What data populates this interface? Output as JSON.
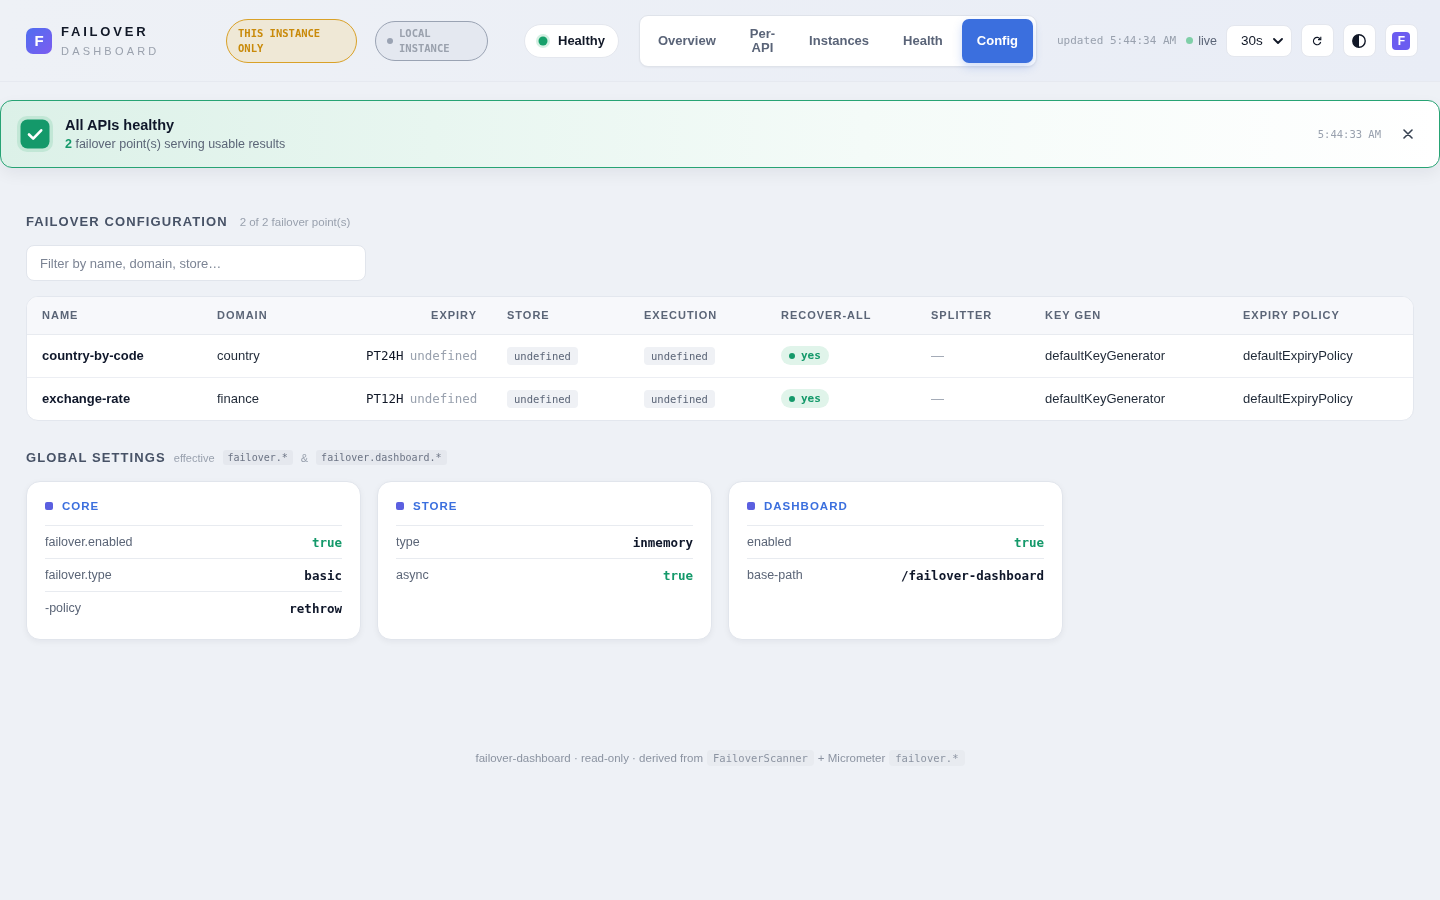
{
  "brand": {
    "logo": "F",
    "title": "FAILOVER",
    "subtitle": "DASHBOARD"
  },
  "badges": [
    {
      "kind": "scope",
      "label": "THIS INSTANCE ONLY"
    },
    {
      "kind": "local",
      "label": "LOCAL INSTANCE"
    }
  ],
  "health": {
    "kind": "ok",
    "label": "Healthy"
  },
  "tabs": [
    {
      "label": "Overview",
      "selected": false
    },
    {
      "label": "Per-API",
      "selected": false
    },
    {
      "label": "Instances",
      "selected": false
    },
    {
      "label": "Health",
      "selected": false
    },
    {
      "label": "Config",
      "selected": true
    }
  ],
  "updated": "updated 5:44:34 AM",
  "live": {
    "label": "live",
    "on": true
  },
  "interval": {
    "value": "30s"
  },
  "app_button": {
    "label": "F"
  },
  "alert": {
    "kind": "success",
    "title": "All APIs healthy",
    "count": "2",
    "message": "failover point(s) serving usable results",
    "time": "5:44:33 AM"
  },
  "failover_config": {
    "title": "FAILOVER CONFIGURATION",
    "summary": "2 of 2 failover point(s)",
    "filter": {
      "placeholder": "Filter by name, domain, store…"
    },
    "table": {
      "columns": [
        {
          "label": "NAME",
          "kind": "text"
        },
        {
          "label": "DOMAIN",
          "kind": "text"
        },
        {
          "label": "EXPIRY",
          "kind": "expiry"
        },
        {
          "label": "STORE",
          "kind": "text"
        },
        {
          "label": "EXECUTION",
          "kind": "text"
        },
        {
          "label": "RECOVER-ALL",
          "kind": "text"
        },
        {
          "label": "SPLITTER",
          "kind": "text"
        },
        {
          "label": "KEY GEN",
          "kind": "text"
        },
        {
          "label": "EXPIRY POLICY",
          "kind": "text"
        }
      ],
      "rows": [
        {
          "cells": [
            {
              "kind": "name",
              "text": "country-by-code"
            },
            {
              "kind": "text",
              "text": "country"
            },
            {
              "kind": "expiry",
              "value": "PT24H",
              "note": "undefined"
            },
            {
              "kind": "chip",
              "text": "undefined"
            },
            {
              "kind": "chip",
              "text": "undefined"
            },
            {
              "kind": "flag",
              "text": "yes",
              "on": true
            },
            {
              "kind": "muted",
              "text": "—"
            },
            {
              "kind": "text",
              "text": "defaultKeyGenerator"
            },
            {
              "kind": "text",
              "text": "defaultExpiryPolicy"
            }
          ]
        },
        {
          "cells": [
            {
              "kind": "name",
              "text": "exchange-rate"
            },
            {
              "kind": "text",
              "text": "finance"
            },
            {
              "kind": "expiry",
              "value": "PT12H",
              "note": "undefined"
            },
            {
              "kind": "chip",
              "text": "undefined"
            },
            {
              "kind": "chip",
              "text": "undefined"
            },
            {
              "kind": "flag",
              "text": "yes",
              "on": true
            },
            {
              "kind": "muted",
              "text": "—"
            },
            {
              "kind": "text",
              "text": "defaultKeyGenerator"
            },
            {
              "kind": "text",
              "text": "defaultExpiryPolicy"
            }
          ]
        }
      ]
    }
  },
  "global_settings": {
    "title": "GLOBAL SETTINGS",
    "scope": [
      {
        "kind": "text",
        "text": "effective"
      },
      {
        "kind": "code",
        "text": "failover.*"
      },
      {
        "kind": "text",
        "text": "&"
      },
      {
        "kind": "code",
        "text": "failover.dashboard.*"
      }
    ],
    "cards": [
      {
        "title": "CORE",
        "rows": [
          {
            "key": "failover.enabled",
            "value": "true",
            "kind": "bool"
          },
          {
            "key": "failover.type",
            "value": "basic",
            "kind": "text"
          },
          {
            "key": "-policy",
            "value": "rethrow",
            "kind": "text"
          }
        ]
      },
      {
        "title": "STORE",
        "rows": [
          {
            "key": "type",
            "value": "inmemory",
            "kind": "text"
          },
          {
            "key": "async",
            "value": "true",
            "kind": "bool"
          }
        ]
      },
      {
        "title": "DASHBOARD",
        "rows": [
          {
            "key": "enabled",
            "value": "true",
            "kind": "bool"
          },
          {
            "key": "base-path",
            "value": "/failover-dashboard",
            "kind": "text"
          }
        ]
      }
    ]
  },
  "footer": [
    {
      "kind": "text",
      "text": "failover-dashboard · read-only · derived from"
    },
    {
      "kind": "code",
      "text": "FailoverScanner"
    },
    {
      "kind": "text",
      "text": "+ Micrometer"
    },
    {
      "kind": "code",
      "text": "failover.*"
    }
  ]
}
